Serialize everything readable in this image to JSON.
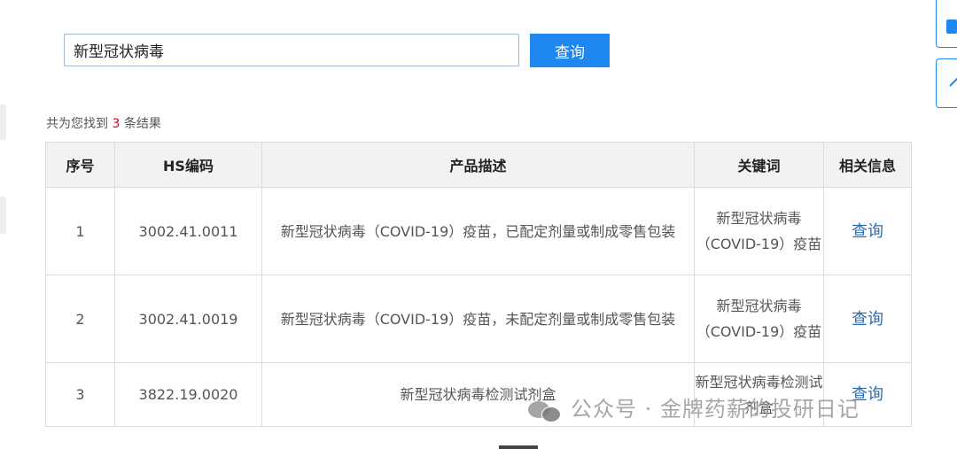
{
  "search": {
    "value": "新型冠状病毒",
    "button_label": "查询"
  },
  "summary": {
    "prefix": "共为您找到 ",
    "count": "3",
    "suffix": " 条结果"
  },
  "table": {
    "headers": {
      "index": "序号",
      "hs_code": "HS编码",
      "description": "产品描述",
      "keywords": "关键词",
      "related": "相关信息"
    },
    "rows": [
      {
        "index": "1",
        "hs_code": "3002.41.0011",
        "description": "新型冠状病毒（COVID-19）疫苗，已配定剂量或制成零售包装",
        "keywords": "新型冠状病毒（COVID-19）疫苗",
        "related": "查询"
      },
      {
        "index": "2",
        "hs_code": "3002.41.0019",
        "description": "新型冠状病毒（COVID-19）疫苗，未配定剂量或制成零售包装",
        "keywords": "新型冠状病毒（COVID-19）疫苗",
        "related": "查询"
      },
      {
        "index": "3",
        "hs_code": "3822.19.0020",
        "description": "新型冠状病毒检测试剂盒",
        "keywords": "新型冠状病毒检测试剂盒",
        "related": "查询"
      }
    ]
  },
  "watermark": {
    "text": "公众号 · 金牌药薪的投研日记"
  },
  "colors": {
    "accent": "#1e87f0",
    "count_highlight": "#d9001b",
    "link": "#2a6cb0",
    "header_bg": "#f2f2f2",
    "border": "#dcdcdc"
  },
  "icons": {
    "right_top": "thumbs-up-icon",
    "right_bottom": "chevron-up-icon",
    "watermark_logo": "wechat-icon"
  }
}
